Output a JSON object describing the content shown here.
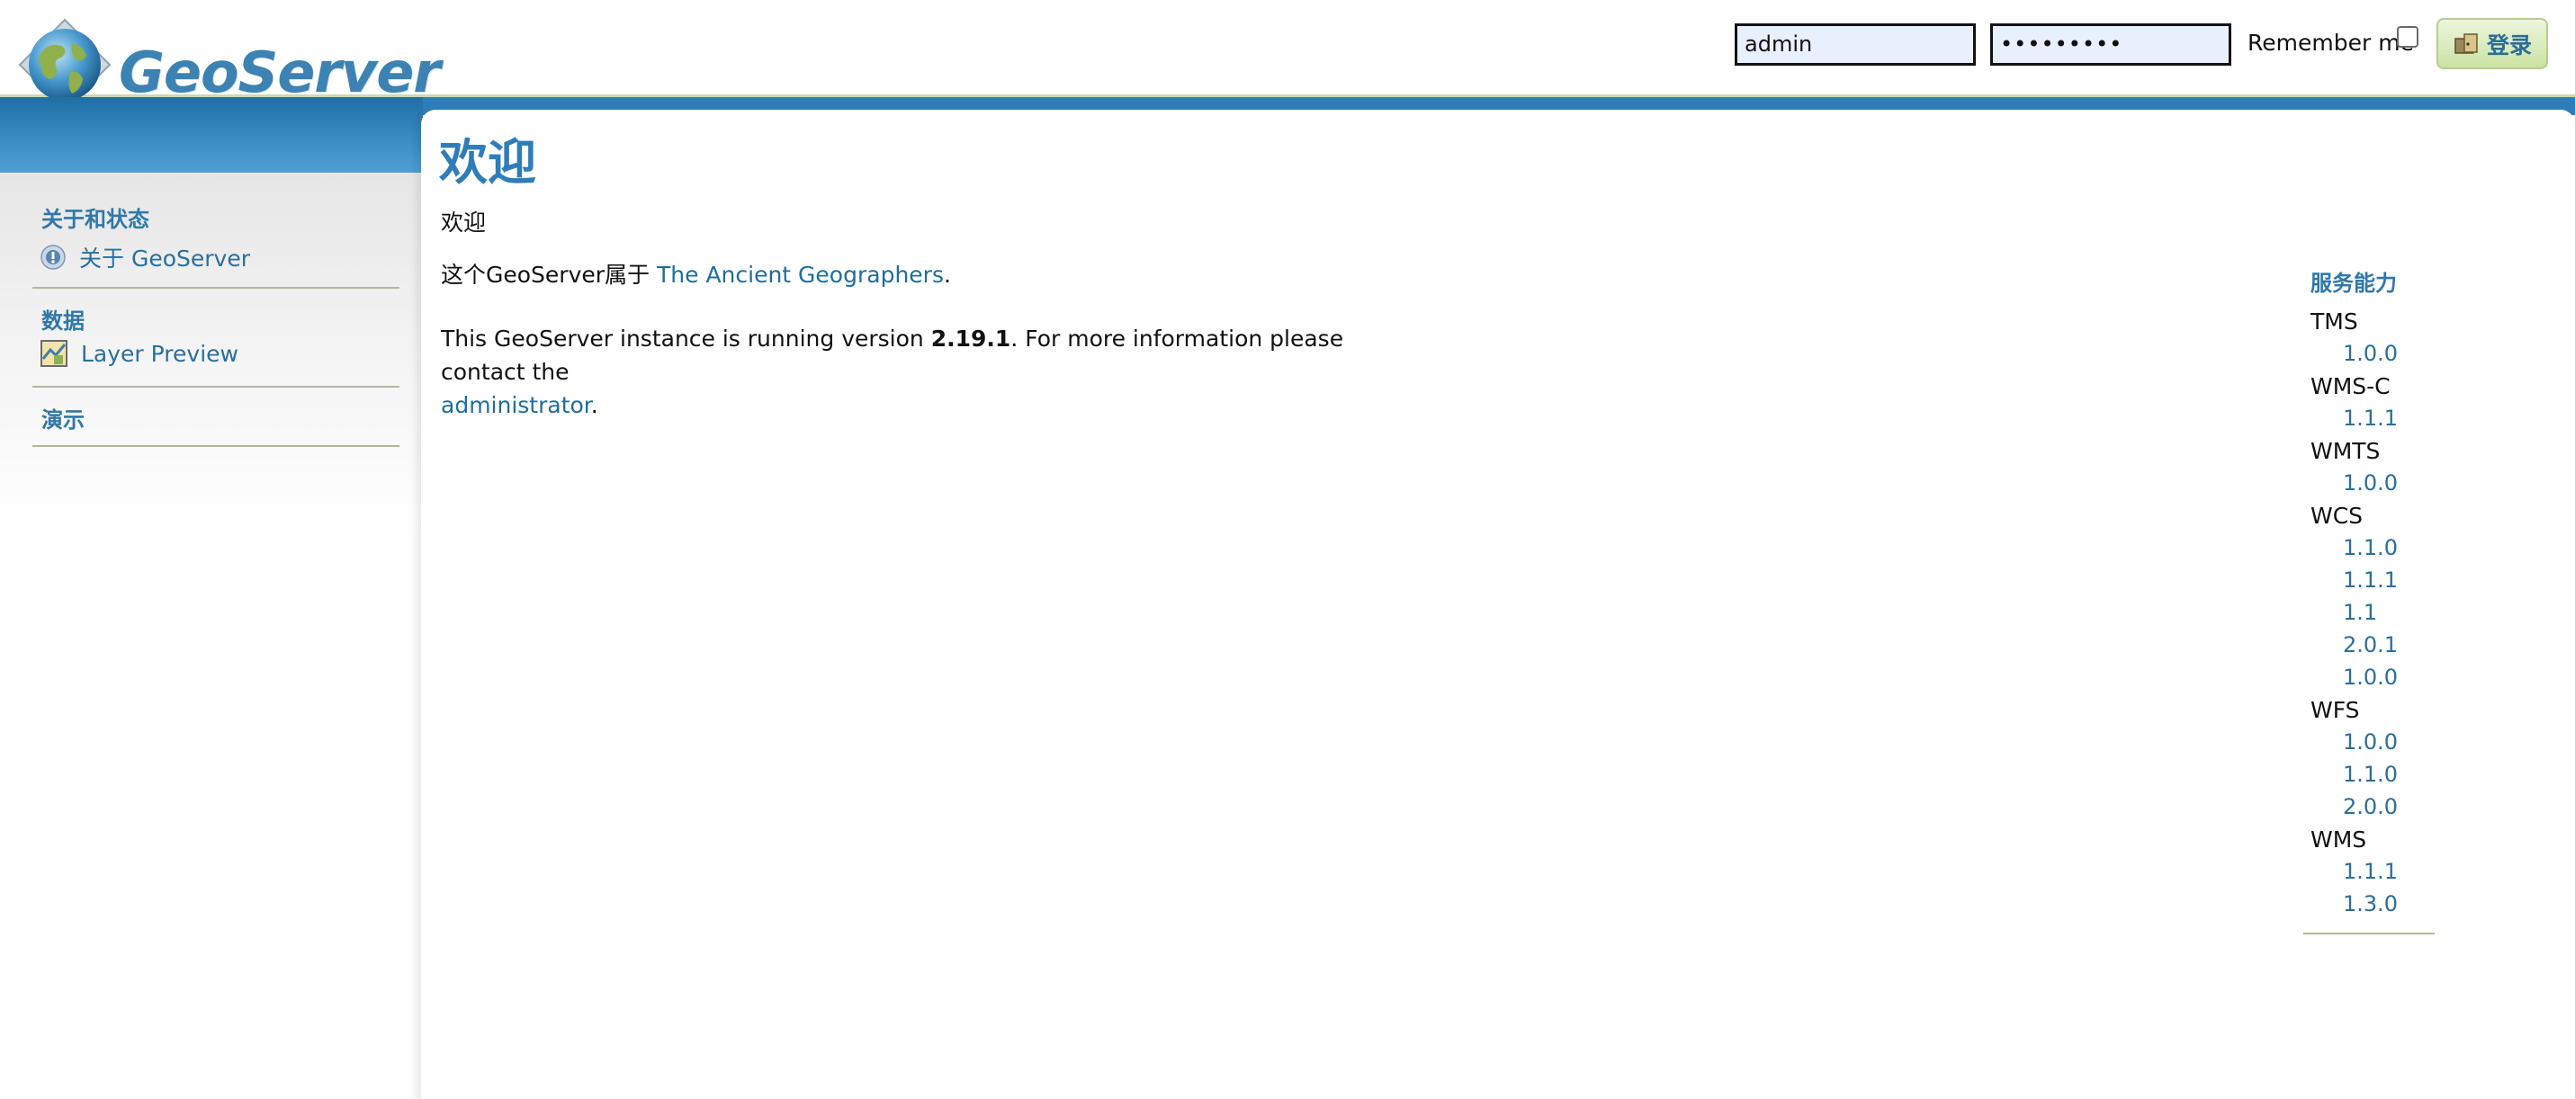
{
  "header": {
    "logo_text": "GeoServer",
    "username_value": "admin",
    "password_value": "•••••••••",
    "remember_label": "Remember me",
    "login_label": "登录"
  },
  "sidebar": {
    "sections": [
      {
        "heading": "关于和状态",
        "links": [
          {
            "label": "关于 GeoServer",
            "icon": "about-icon"
          }
        ]
      },
      {
        "heading": "数据",
        "links": [
          {
            "label": "Layer Preview",
            "icon": "layer-preview-icon"
          }
        ]
      },
      {
        "heading": "演示",
        "links": []
      }
    ]
  },
  "main": {
    "title": "欢迎",
    "welcome_text": "欢迎",
    "owner_prefix": "这个GeoServer属于",
    "owner_link": "The Ancient Geographers",
    "owner_suffix": ".",
    "version_prefix": "This GeoServer instance is running version",
    "version": "2.19.1",
    "version_middle": ". For more information please contact the",
    "admin_link": "administrator",
    "admin_suffix": "."
  },
  "capabilities": {
    "title": "服务能力",
    "services": [
      {
        "name": "TMS",
        "versions": [
          "1.0.0"
        ]
      },
      {
        "name": "WMS-C",
        "versions": [
          "1.1.1"
        ]
      },
      {
        "name": "WMTS",
        "versions": [
          "1.0.0"
        ]
      },
      {
        "name": "WCS",
        "versions": [
          "1.1.0",
          "1.1.1",
          "1.1",
          "2.0.1",
          "1.0.0"
        ]
      },
      {
        "name": "WFS",
        "versions": [
          "1.0.0",
          "1.1.0",
          "2.0.0"
        ]
      },
      {
        "name": "WMS",
        "versions": [
          "1.1.1",
          "1.3.0"
        ]
      }
    ]
  },
  "colors": {
    "accent": "#2f7db8",
    "link": "#2a6f9e",
    "band": "#2c7fb6"
  }
}
